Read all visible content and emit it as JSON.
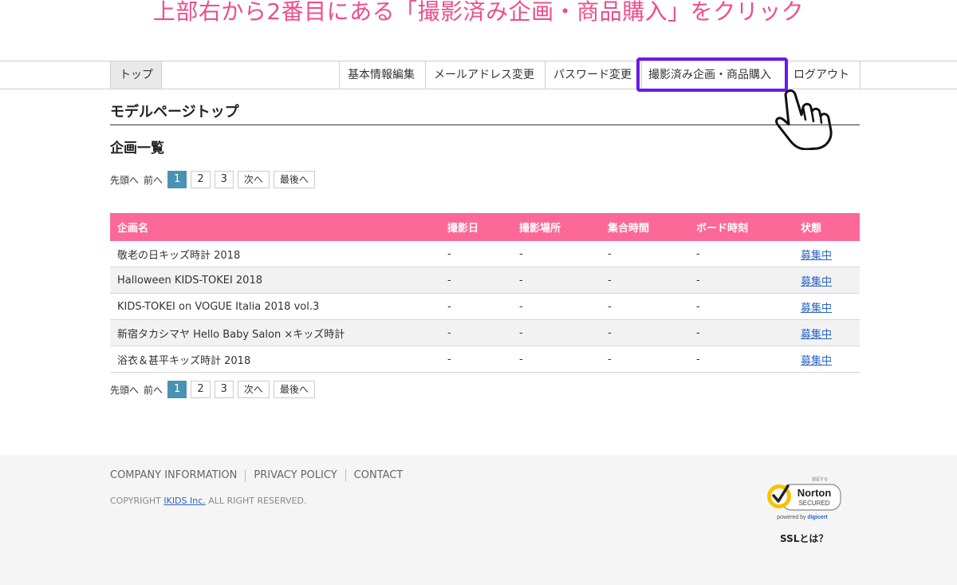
{
  "instruction": "上部右から2番目にある「撮影済み企画・商品購入」をクリック",
  "nav": {
    "top": "トップ",
    "items": [
      "基本情報編集",
      "メールアドレス変更",
      "パスワード変更",
      "撮影済み企画・商品購入",
      "ログアウト"
    ]
  },
  "page_title": "モデルページトップ",
  "section_title": "企画一覧",
  "pager": {
    "first": "先頭へ",
    "prev": "前へ",
    "pages": [
      "1",
      "2",
      "3"
    ],
    "next": "次へ",
    "last": "最後へ"
  },
  "table": {
    "headers": [
      "企画名",
      "撮影日",
      "撮影場所",
      "集合時間",
      "ボード時刻",
      "状態"
    ],
    "rows": [
      [
        "敬老の日キッズ時計 2018",
        "-",
        "-",
        "-",
        "-",
        "募集中"
      ],
      [
        "Halloween KIDS-TOKEI 2018",
        "-",
        "-",
        "-",
        "-",
        "募集中"
      ],
      [
        "KIDS-TOKEI on VOGUE Italia 2018 vol.3",
        "-",
        "-",
        "-",
        "-",
        "募集中"
      ],
      [
        "新宿タカシマヤ Hello Baby Salon ×キッズ時計",
        "-",
        "-",
        "-",
        "-",
        "募集中"
      ],
      [
        "浴衣＆甚平キッズ時計 2018",
        "-",
        "-",
        "-",
        "-",
        "募集中"
      ]
    ]
  },
  "footer": {
    "links": [
      "COMPANY INFORMATION",
      "PRIVACY POLICY",
      "CONTACT"
    ],
    "copyright_prefix": "COPYRIGHT ",
    "company": "IKIDS Inc.",
    "copyright_suffix": " ALL RIGHT RESERVED.",
    "norton_small": "認証する",
    "norton_name": "Norton",
    "norton_secured": "SECURED",
    "norton_powered": "powered by ",
    "norton_digicert": "digicert",
    "ssl_label": "SSLとは？"
  },
  "colors": {
    "instruction": "#ee4d8c",
    "table_header": "#fc6897",
    "highlight": "#6a1be8",
    "current_page": "#4a92b1",
    "link": "#2a65c4"
  }
}
